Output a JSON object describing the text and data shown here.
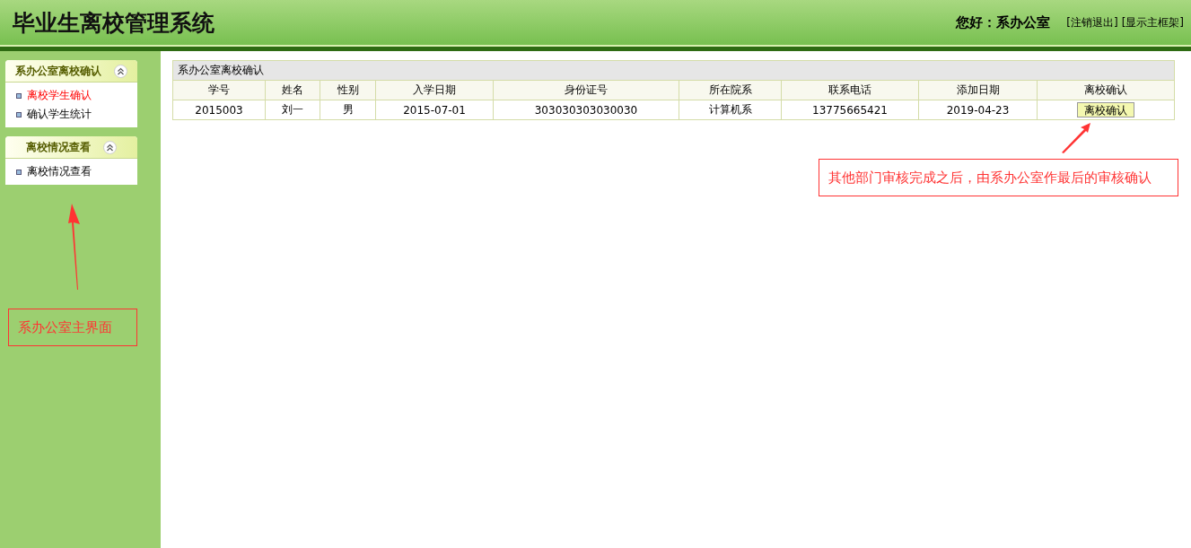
{
  "header": {
    "title": "毕业生离校管理系统",
    "greeting": "您好：系办公室",
    "links": [
      "[注销退出]",
      "[显示主框架]"
    ]
  },
  "sidebar": {
    "panels": [
      {
        "title": "系办公室离校确认",
        "expanded": true,
        "items": [
          {
            "label": "离校学生确认",
            "selected": true
          },
          {
            "label": "确认学生统计",
            "selected": false
          }
        ]
      },
      {
        "title": "离校情况查看",
        "expanded": true,
        "items": [
          {
            "label": "离校情况查看",
            "selected": false
          }
        ]
      }
    ]
  },
  "table": {
    "caption": "系办公室离校确认",
    "columns": [
      "学号",
      "姓名",
      "性别",
      "入学日期",
      "身份证号",
      "所在院系",
      "联系电话",
      "添加日期",
      "离校确认"
    ],
    "rows": [
      {
        "cells": [
          "2015003",
          "刘一",
          "男",
          "2015-07-01",
          "303030303030030",
          "计算机系",
          "13775665421",
          "2019-04-23"
        ],
        "action": "离校确认"
      }
    ]
  },
  "annotations": [
    {
      "text": "其他部门审核完成之后，由系办公室作最后的审核确认",
      "kind": "table"
    },
    {
      "text": "系办公室主界面",
      "kind": "sidebar"
    }
  ]
}
